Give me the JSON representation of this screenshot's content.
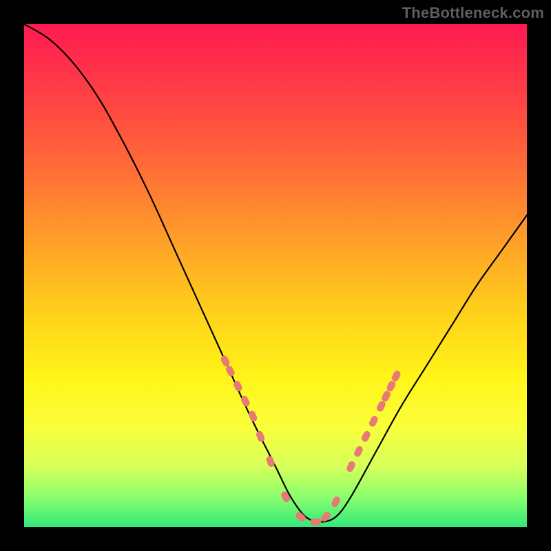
{
  "watermark": "TheBottleneck.com",
  "chart_data": {
    "type": "line",
    "title": "",
    "xlabel": "",
    "ylabel": "",
    "xlim": [
      0,
      100
    ],
    "ylim": [
      0,
      100
    ],
    "series": [
      {
        "name": "bottleneck-curve",
        "x": [
          0,
          5,
          10,
          15,
          20,
          25,
          30,
          35,
          40,
          45,
          50,
          53,
          56,
          59,
          62,
          65,
          70,
          75,
          80,
          85,
          90,
          95,
          100
        ],
        "y": [
          100,
          97,
          92,
          85,
          76,
          66,
          55,
          44,
          33,
          22,
          12,
          6,
          2,
          1,
          2,
          6,
          15,
          24,
          32,
          40,
          48,
          55,
          62
        ]
      }
    ],
    "markers": {
      "name": "highlight-dots",
      "color": "#e77a74",
      "x": [
        40,
        41,
        42.5,
        44,
        45.5,
        47,
        49,
        52,
        55,
        58,
        60,
        62,
        65,
        66.5,
        68,
        69.5,
        71,
        72,
        73,
        74
      ],
      "y": [
        33,
        31,
        28,
        25,
        22,
        18,
        13,
        6,
        2,
        1,
        2,
        5,
        12,
        15,
        18,
        21,
        24,
        26,
        28,
        30
      ]
    }
  }
}
